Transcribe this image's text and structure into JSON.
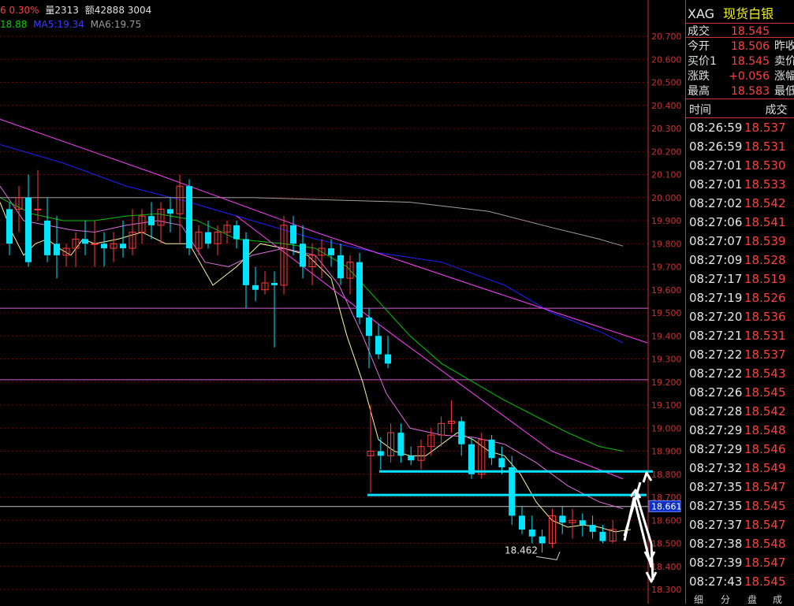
{
  "topbar": {
    "change": "6 0.30%",
    "volume": "量2313",
    "amount": "额42888 3004"
  },
  "ma_bar": {
    "ma_left": "18.88",
    "ma5": "MA5:19.34",
    "ma6": "MA6:19.75"
  },
  "colors": {
    "up": "#ff3a3a",
    "down": "#00e5ff",
    "grid": "#7a0000",
    "panel_border": "#c33333",
    "highlight": "#00e5ff"
  },
  "quote": {
    "symbol": "XAG",
    "name": "现货白银",
    "rows": [
      {
        "label": "成交",
        "value": "18.545",
        "extra": ""
      },
      {
        "label": "今开",
        "value": "18.506",
        "extra": "昨收"
      },
      {
        "label": "买价1",
        "value": "18.545",
        "extra": "卖价"
      },
      {
        "label": "涨跌",
        "value": "+0.056",
        "extra": "涨幅"
      },
      {
        "label": "最高",
        "value": "18.583",
        "extra": "最低"
      }
    ],
    "tick_header": {
      "time": "时间",
      "price": "成交"
    },
    "ticks": [
      {
        "time": "08:26:59",
        "price": "18.537"
      },
      {
        "time": "08:26:59",
        "price": "18.531"
      },
      {
        "time": "08:27:01",
        "price": "18.530"
      },
      {
        "time": "08:27:01",
        "price": "18.533"
      },
      {
        "time": "08:27:02",
        "price": "18.542"
      },
      {
        "time": "08:27:06",
        "price": "18.541"
      },
      {
        "time": "08:27:07",
        "price": "18.539"
      },
      {
        "time": "08:27:09",
        "price": "18.528"
      },
      {
        "time": "08:27:17",
        "price": "18.519"
      },
      {
        "time": "08:27:19",
        "price": "18.526"
      },
      {
        "time": "08:27:20",
        "price": "18.536"
      },
      {
        "time": "08:27:21",
        "price": "18.531"
      },
      {
        "time": "08:27:22",
        "price": "18.537"
      },
      {
        "time": "08:27:22",
        "price": "18.543"
      },
      {
        "time": "08:27:26",
        "price": "18.545"
      },
      {
        "time": "08:27:28",
        "price": "18.542"
      },
      {
        "time": "08:27:29",
        "price": "18.548"
      },
      {
        "time": "08:27:29",
        "price": "18.546"
      },
      {
        "time": "08:27:32",
        "price": "18.549"
      },
      {
        "time": "08:27:35",
        "price": "18.547"
      },
      {
        "time": "08:27:35",
        "price": "18.545"
      },
      {
        "time": "08:27:37",
        "price": "18.547"
      },
      {
        "time": "08:27:38",
        "price": "18.548"
      },
      {
        "time": "08:27:39",
        "price": "18.547"
      },
      {
        "time": "08:27:43",
        "price": "18.545"
      }
    ],
    "tabs": [
      "细",
      "分",
      "盘",
      "成"
    ]
  },
  "chart_data": {
    "type": "candlestick",
    "y_range": [
      18.27,
      20.73
    ],
    "y_ticks": [
      "20.700",
      "20.600",
      "20.500",
      "20.400",
      "20.300",
      "20.200",
      "20.100",
      "20.000",
      "19.900",
      "19.800",
      "19.700",
      "19.600",
      "19.500",
      "19.400",
      "19.300",
      "19.200",
      "19.100",
      "19.000",
      "18.900",
      "18.800",
      "18.700",
      "18.600",
      "18.500",
      "18.400",
      "18.300"
    ],
    "current_price": "18.661",
    "low_label": "18.462",
    "candles": [
      [
        19.95,
        19.98,
        19.75,
        19.8
      ],
      [
        19.95,
        20.05,
        19.85,
        20.0
      ],
      [
        20.0,
        20.1,
        19.7,
        19.72
      ],
      [
        19.95,
        20.12,
        19.9,
        19.95
      ],
      [
        19.9,
        20.0,
        19.72,
        19.75
      ],
      [
        19.8,
        19.92,
        19.65,
        19.75
      ],
      [
        19.75,
        19.8,
        19.7,
        19.78
      ],
      [
        19.78,
        19.85,
        19.7,
        19.82
      ],
      [
        19.82,
        19.9,
        19.75,
        19.8
      ],
      [
        19.8,
        19.9,
        19.7,
        19.8
      ],
      [
        19.8,
        19.85,
        19.7,
        19.78
      ],
      [
        19.78,
        19.85,
        19.72,
        19.8
      ],
      [
        19.8,
        19.9,
        19.74,
        19.78
      ],
      [
        19.78,
        19.95,
        19.75,
        19.85
      ],
      [
        19.85,
        19.95,
        19.8,
        19.92
      ],
      [
        19.92,
        19.98,
        19.82,
        19.88
      ],
      [
        19.88,
        19.98,
        19.8,
        19.95
      ],
      [
        19.95,
        20.0,
        19.85,
        19.93
      ],
      [
        19.93,
        20.1,
        19.8,
        20.05
      ],
      [
        20.05,
        20.08,
        19.75,
        19.78
      ],
      [
        19.78,
        19.88,
        19.75,
        19.85
      ],
      [
        19.85,
        19.9,
        19.78,
        19.8
      ],
      [
        19.8,
        19.88,
        19.75,
        19.85
      ],
      [
        19.85,
        19.9,
        19.8,
        19.88
      ],
      [
        19.88,
        19.9,
        19.78,
        19.82
      ],
      [
        19.82,
        19.85,
        19.52,
        19.62
      ],
      [
        19.62,
        19.7,
        19.55,
        19.6
      ],
      [
        19.6,
        19.68,
        19.58,
        19.63
      ],
      [
        19.63,
        19.68,
        19.35,
        19.62
      ],
      [
        19.62,
        19.92,
        19.58,
        19.88
      ],
      [
        19.88,
        19.92,
        19.75,
        19.8
      ],
      [
        19.8,
        19.88,
        19.65,
        19.7
      ],
      [
        19.7,
        19.8,
        19.62,
        19.75
      ],
      [
        19.75,
        19.82,
        19.65,
        19.78
      ],
      [
        19.78,
        19.82,
        19.7,
        19.75
      ],
      [
        19.75,
        19.8,
        19.62,
        19.65
      ],
      [
        19.65,
        19.75,
        19.58,
        19.72
      ],
      [
        19.72,
        19.76,
        19.45,
        19.48
      ],
      [
        19.48,
        19.52,
        19.26,
        19.4
      ],
      [
        19.4,
        19.45,
        19.3,
        19.32
      ],
      [
        19.32,
        19.4,
        19.26,
        19.28
      ],
      [
        18.88,
        19.1,
        18.72,
        18.9
      ],
      [
        18.9,
        18.96,
        18.82,
        18.88
      ],
      [
        18.88,
        19.02,
        18.85,
        18.98
      ],
      [
        18.98,
        19.02,
        18.85,
        18.88
      ],
      [
        18.88,
        18.92,
        18.84,
        18.86
      ],
      [
        18.86,
        18.95,
        18.82,
        18.92
      ],
      [
        18.92,
        19.0,
        18.88,
        18.97
      ],
      [
        18.97,
        19.05,
        18.92,
        19.02
      ],
      [
        19.02,
        19.12,
        18.98,
        19.03
      ],
      [
        19.03,
        19.05,
        18.88,
        18.93
      ],
      [
        18.93,
        18.96,
        18.78,
        18.8
      ],
      [
        18.8,
        18.98,
        18.78,
        18.95
      ],
      [
        18.95,
        18.97,
        18.84,
        18.87
      ],
      [
        18.87,
        18.92,
        18.8,
        18.83
      ],
      [
        18.83,
        18.88,
        18.58,
        18.62
      ],
      [
        18.62,
        18.66,
        18.54,
        18.56
      ],
      [
        18.56,
        18.62,
        18.5,
        18.53
      ],
      [
        18.53,
        18.56,
        18.46,
        18.5
      ],
      [
        18.5,
        18.65,
        18.48,
        18.62
      ],
      [
        18.62,
        18.66,
        18.54,
        18.59
      ],
      [
        18.59,
        18.65,
        18.52,
        18.6
      ],
      [
        18.6,
        18.63,
        18.53,
        18.58
      ],
      [
        18.58,
        18.62,
        18.52,
        18.55
      ],
      [
        18.55,
        18.58,
        18.5,
        18.51
      ],
      [
        18.51,
        18.6,
        18.5,
        18.56
      ]
    ],
    "ma_lines": [
      {
        "color": "#f5f5a0",
        "points": [
          [
            0,
            19.98
          ],
          [
            15,
            19.85
          ],
          [
            30,
            19.75
          ],
          [
            45,
            19.8
          ],
          [
            60,
            19.82
          ],
          [
            75,
            19.78
          ],
          [
            90,
            19.75
          ],
          [
            105,
            19.82
          ],
          [
            120,
            19.8
          ],
          [
            150,
            19.82
          ],
          [
            180,
            19.85
          ],
          [
            210,
            19.8
          ],
          [
            240,
            19.8
          ],
          [
            270,
            19.62
          ],
          [
            300,
            19.7
          ],
          [
            330,
            19.8
          ],
          [
            360,
            19.78
          ],
          [
            390,
            19.75
          ],
          [
            420,
            19.65
          ],
          [
            440,
            19.4
          ],
          [
            460,
            19.2
          ],
          [
            480,
            18.95
          ],
          [
            500,
            18.9
          ],
          [
            520,
            18.88
          ],
          [
            540,
            18.88
          ],
          [
            560,
            18.93
          ],
          [
            580,
            18.98
          ],
          [
            600,
            18.95
          ],
          [
            620,
            18.9
          ],
          [
            640,
            18.88
          ],
          [
            660,
            18.8
          ],
          [
            680,
            18.68
          ],
          [
            700,
            18.6
          ],
          [
            720,
            18.57
          ],
          [
            740,
            18.58
          ],
          [
            760,
            18.57
          ],
          [
            780,
            18.55
          ],
          [
            800,
            18.56
          ]
        ]
      },
      {
        "color": "#e06ce0",
        "points": [
          [
            0,
            20.05
          ],
          [
            30,
            19.9
          ],
          [
            60,
            19.88
          ],
          [
            90,
            19.86
          ],
          [
            120,
            19.85
          ],
          [
            160,
            19.88
          ],
          [
            200,
            19.9
          ],
          [
            230,
            19.88
          ],
          [
            260,
            19.72
          ],
          [
            290,
            19.7
          ],
          [
            320,
            19.75
          ],
          [
            360,
            19.78
          ],
          [
            400,
            19.75
          ],
          [
            430,
            19.62
          ],
          [
            460,
            19.4
          ],
          [
            490,
            19.15
          ],
          [
            520,
            19.0
          ],
          [
            560,
            18.97
          ],
          [
            600,
            18.96
          ],
          [
            640,
            18.93
          ],
          [
            680,
            18.85
          ],
          [
            720,
            18.75
          ],
          [
            760,
            18.68
          ],
          [
            790,
            18.65
          ]
        ]
      },
      {
        "color": "#00c800",
        "points": [
          [
            0,
            20.0
          ],
          [
            40,
            19.93
          ],
          [
            80,
            19.9
          ],
          [
            120,
            19.9
          ],
          [
            160,
            19.92
          ],
          [
            200,
            19.93
          ],
          [
            250,
            19.9
          ],
          [
            300,
            19.82
          ],
          [
            360,
            19.8
          ],
          [
            400,
            19.78
          ],
          [
            440,
            19.7
          ],
          [
            480,
            19.55
          ],
          [
            520,
            19.4
          ],
          [
            560,
            19.28
          ],
          [
            600,
            19.2
          ],
          [
            640,
            19.12
          ],
          [
            680,
            19.05
          ],
          [
            720,
            18.98
          ],
          [
            760,
            18.92
          ],
          [
            790,
            18.9
          ]
        ]
      },
      {
        "color": "#2020ff",
        "points": [
          [
            0,
            20.23
          ],
          [
            80,
            20.15
          ],
          [
            160,
            20.05
          ],
          [
            240,
            19.98
          ],
          [
            320,
            19.9
          ],
          [
            400,
            19.82
          ],
          [
            480,
            19.76
          ],
          [
            560,
            19.72
          ],
          [
            640,
            19.62
          ],
          [
            700,
            19.5
          ],
          [
            760,
            19.42
          ],
          [
            790,
            19.37
          ]
        ]
      },
      {
        "color": "#a0a0a0",
        "points": [
          [
            0,
            20.0
          ],
          [
            100,
            20.0
          ],
          [
            200,
            20.0
          ],
          [
            320,
            20.0
          ],
          [
            420,
            19.99
          ],
          [
            520,
            19.98
          ],
          [
            620,
            19.94
          ],
          [
            700,
            19.87
          ],
          [
            760,
            19.82
          ],
          [
            790,
            19.79
          ]
        ]
      },
      {
        "color": "#ff40ff",
        "points": [
          [
            0,
            20.34
          ],
          [
            200,
            20.1
          ],
          [
            400,
            19.85
          ],
          [
            600,
            19.62
          ],
          [
            821,
            19.37
          ]
        ]
      },
      {
        "color": "#ff40ff",
        "points": [
          [
            300,
            19.92
          ],
          [
            500,
            19.4
          ],
          [
            700,
            18.9
          ],
          [
            790,
            18.78
          ]
        ]
      }
    ],
    "h_lines": [
      {
        "y": 19.52,
        "color": "#d060d0"
      },
      {
        "y": 19.21,
        "color": "#d060d0"
      },
      {
        "y": 18.66,
        "color": "#c0c0c0"
      }
    ],
    "support_lines": [
      {
        "x1": 481,
        "x2": 828,
        "y": 18.812
      },
      {
        "x1": 466,
        "x2": 820,
        "y": 18.71
      }
    ]
  }
}
